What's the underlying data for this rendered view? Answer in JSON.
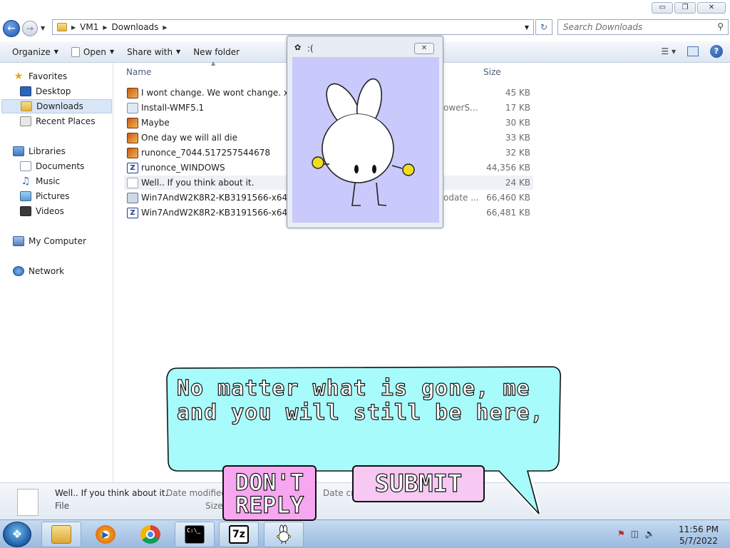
{
  "window": {
    "buttons": {
      "minimize": "▭",
      "maximize": "❐",
      "close": "✕"
    }
  },
  "address": {
    "crumbs": [
      "VM1",
      "Downloads"
    ],
    "search_placeholder": "Search Downloads"
  },
  "toolbar": {
    "organize": "Organize",
    "open": "Open",
    "share_with": "Share with",
    "new_folder": "New folder"
  },
  "nav": {
    "favorites": "Favorites",
    "desktop": "Desktop",
    "downloads": "Downloads",
    "recent_places": "Recent Places",
    "libraries": "Libraries",
    "documents": "Documents",
    "music": "Music",
    "pictures": "Pictures",
    "videos": "Videos",
    "my_computer": "My Computer",
    "network": "Network"
  },
  "columns": {
    "name": "Name",
    "size": "Size"
  },
  "files": [
    {
      "name": "I wont change. We wont change. x3",
      "type": "",
      "size": "45 KB",
      "icon": "media-icon"
    },
    {
      "name": "Install-WMF5.1",
      "type": "owerS...",
      "size": "17 KB",
      "icon": "setup-icon"
    },
    {
      "name": "Maybe",
      "type": "",
      "size": "30 KB",
      "icon": "media-icon"
    },
    {
      "name": "One day we will all die",
      "type": "",
      "size": "33 KB",
      "icon": "media-icon"
    },
    {
      "name": "runonce_7044.517257544678",
      "type": "",
      "size": "32 KB",
      "icon": "media-icon"
    },
    {
      "name": "runonce_WINDOWS",
      "type": "",
      "size": "44,356 KB",
      "icon": "7zip-icon"
    },
    {
      "name": "Well.. If you think about it.",
      "type": "",
      "size": "24 KB",
      "icon": "text-file-icon"
    },
    {
      "name": "Win7AndW2K8R2-KB3191566-x64",
      "type": "odate ...",
      "size": "66,460 KB",
      "icon": "msu-icon"
    },
    {
      "name": "Win7AndW2K8R2-KB3191566-x64",
      "type": "",
      "size": "66,481 KB",
      "icon": "7zip-icon"
    }
  ],
  "details": {
    "name": "Well.. If you think about it.",
    "date_modified_label": "Date modified",
    "date_created_label": "Date cr",
    "type": "File",
    "size_label": "Size"
  },
  "popup": {
    "title": ":(",
    "close": "✕"
  },
  "bubble": {
    "line1": "No matter what is gone, me",
    "line2": "and you will still be here,"
  },
  "buttons": {
    "dont_reply_1": "DON'T",
    "dont_reply_2": "REPLY",
    "submit": "SUBMIT"
  },
  "taskbar": {
    "cmd": "C:\\_",
    "sevenzip": "7z",
    "time": "11:56 PM",
    "date": "5/7/2022"
  },
  "colors": {
    "bubble_fill": "#a8fbfb",
    "button_fill": "#f6c8f2",
    "popup_canvas": "#c9c9fc",
    "bunny_cheeks": "#f1dd1c"
  }
}
